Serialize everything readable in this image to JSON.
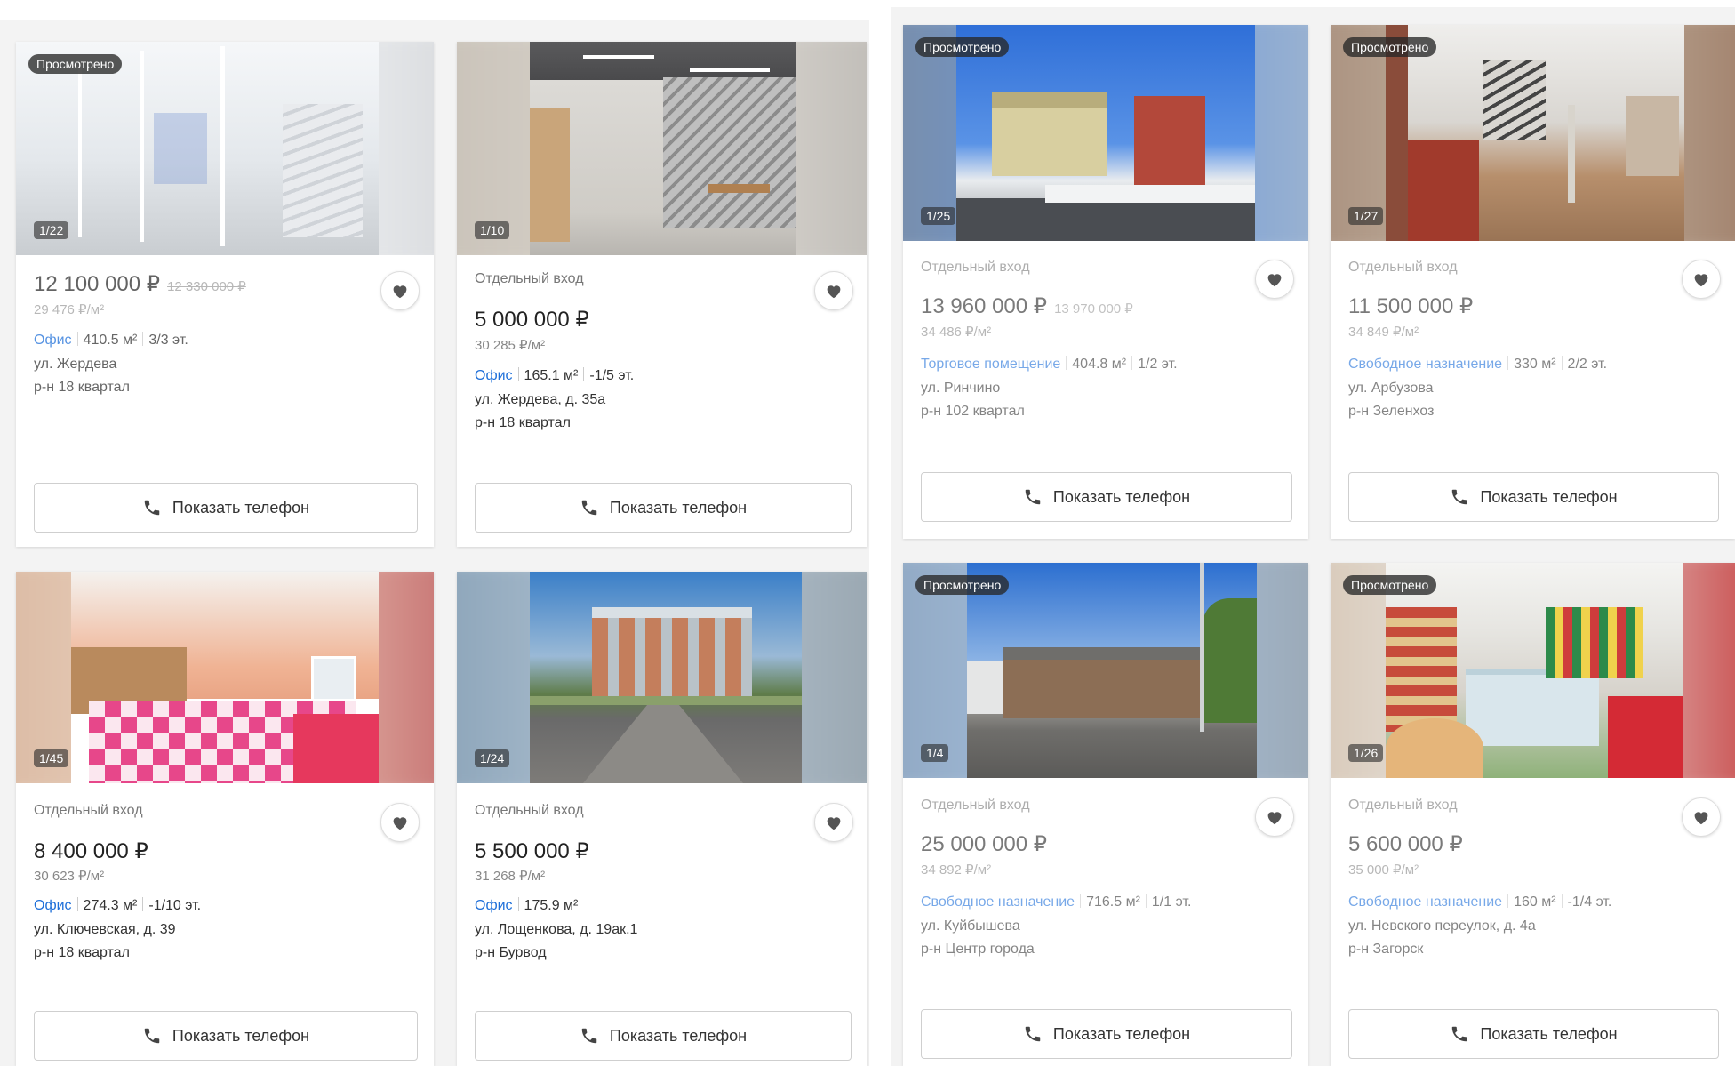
{
  "labels": {
    "viewed": "Просмотрено",
    "phone_button": "Показать телефон"
  },
  "cards": [
    {
      "counter": "1/22",
      "viewed": true,
      "subtitle": "",
      "price": "12 100 000 ₽",
      "old_price": "12 330 000 ₽",
      "ppm": "29 476 ₽/м²",
      "type": "Офис",
      "area": "410.5 м²",
      "floor": "3/3 эт.",
      "street": "ул. Жердева",
      "district": "р-н 18 квартал"
    },
    {
      "counter": "1/10",
      "viewed": false,
      "subtitle": "Отдельный вход",
      "price": "5 000 000 ₽",
      "old_price": "",
      "ppm": "30 285 ₽/м²",
      "type": "Офис",
      "area": "165.1 м²",
      "floor": "-1/5 эт.",
      "street": "ул. Жердева, д. 35а",
      "district": "р-н 18 квартал"
    },
    {
      "counter": "1/25",
      "viewed": true,
      "subtitle": "Отдельный вход",
      "price": "13 960 000 ₽",
      "old_price": "13 970 000 ₽",
      "ppm": "34 486 ₽/м²",
      "type": "Торговое помещение",
      "area": "404.8 м²",
      "floor": "1/2 эт.",
      "street": "ул. Ринчино",
      "district": "р-н 102 квартал"
    },
    {
      "counter": "1/27",
      "viewed": true,
      "subtitle": "Отдельный вход",
      "price": "11 500 000 ₽",
      "old_price": "",
      "ppm": "34 849 ₽/м²",
      "type": "Свободное назначение",
      "area": "330 м²",
      "floor": "2/2 эт.",
      "street": "ул. Арбузова",
      "district": "р-н Зеленхоз"
    },
    {
      "counter": "1/45",
      "viewed": false,
      "subtitle": "Отдельный вход",
      "price": "8 400 000 ₽",
      "old_price": "",
      "ppm": "30 623 ₽/м²",
      "type": "Офис",
      "area": "274.3 м²",
      "floor": "-1/10 эт.",
      "street": "ул. Ключевская, д. 39",
      "district": "р-н 18 квартал"
    },
    {
      "counter": "1/24",
      "viewed": false,
      "subtitle": "Отдельный вход",
      "price": "5 500 000 ₽",
      "old_price": "",
      "ppm": "31 268 ₽/м²",
      "type": "Офис",
      "area": "175.9 м²",
      "floor": "",
      "street": "ул. Лощенкова, д. 19ак.1",
      "district": "р-н Бурвод"
    },
    {
      "counter": "1/4",
      "viewed": true,
      "subtitle": "Отдельный вход",
      "price": "25 000 000 ₽",
      "old_price": "",
      "ppm": "34 892 ₽/м²",
      "type": "Свободное назначение",
      "area": "716.5 м²",
      "floor": "1/1 эт.",
      "street": "ул. Куйбышева",
      "district": "р-н Центр города"
    },
    {
      "counter": "1/26",
      "viewed": true,
      "subtitle": "Отдельный вход",
      "price": "5 600 000 ₽",
      "old_price": "",
      "ppm": "35 000 ₽/м²",
      "type": "Свободное назначение",
      "area": "160 м²",
      "floor": "-1/4 эт.",
      "street": "ул. Невского переулок, д. 4а",
      "district": "р-н Загорск"
    }
  ]
}
